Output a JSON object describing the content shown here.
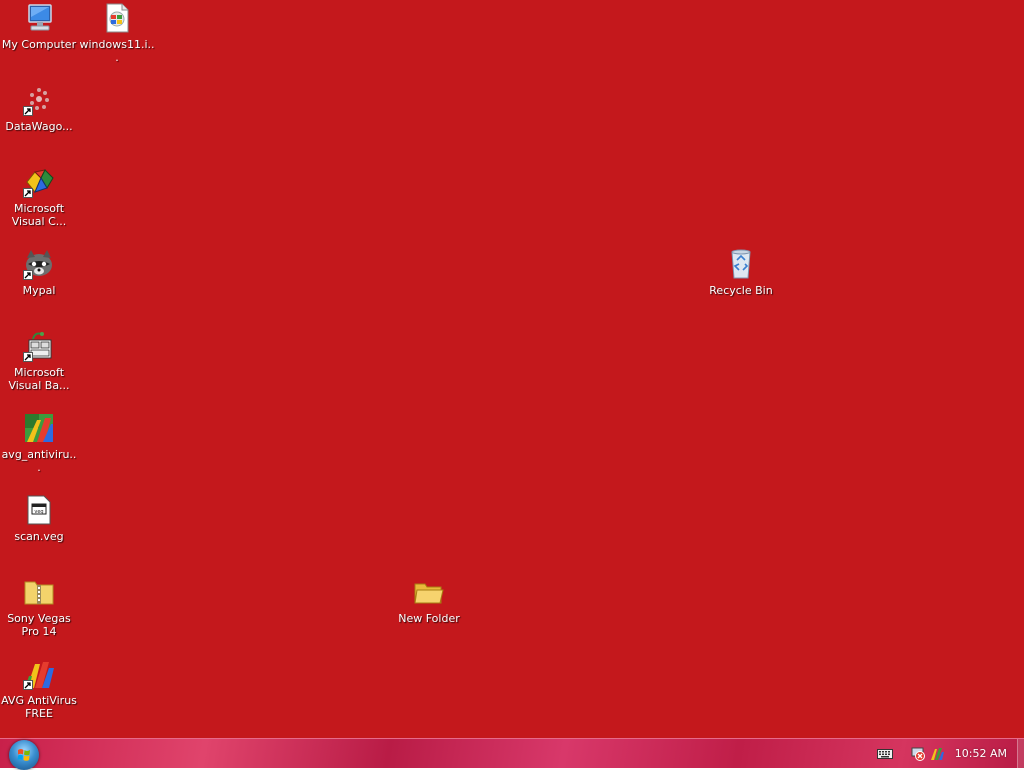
{
  "desktop": {
    "background_color": "#c4181c",
    "icons": [
      {
        "label": "My Computer",
        "icon": "computer-icon"
      },
      {
        "label": "windows11.i...",
        "icon": "disc-image-icon"
      },
      {
        "label": "DataWago...",
        "icon": "datawagon-icon"
      },
      {
        "label": "Microsoft Visual C...",
        "icon": "visual-cpp-icon"
      },
      {
        "label": "Mypal",
        "icon": "mypal-icon"
      },
      {
        "label": "Microsoft Visual Ba...",
        "icon": "visual-basic-icon"
      },
      {
        "label": "avg_antiviru...",
        "icon": "avg-installer-icon"
      },
      {
        "label": "scan.veg",
        "icon": "veg-file-icon"
      },
      {
        "label": "Sony Vegas Pro 14",
        "icon": "zip-folder-icon"
      },
      {
        "label": "AVG AntiVirus FREE",
        "icon": "avg-icon"
      },
      {
        "label": "Recycle Bin",
        "icon": "recycle-bin-icon"
      },
      {
        "label": "New Folder",
        "icon": "folder-icon"
      }
    ]
  },
  "taskbar": {
    "start_button": "start-orb-icon",
    "tray": {
      "icons": [
        "keyboard-icon",
        "network-error-icon",
        "avg-tray-icon"
      ],
      "clock": "10:52 AM"
    }
  }
}
